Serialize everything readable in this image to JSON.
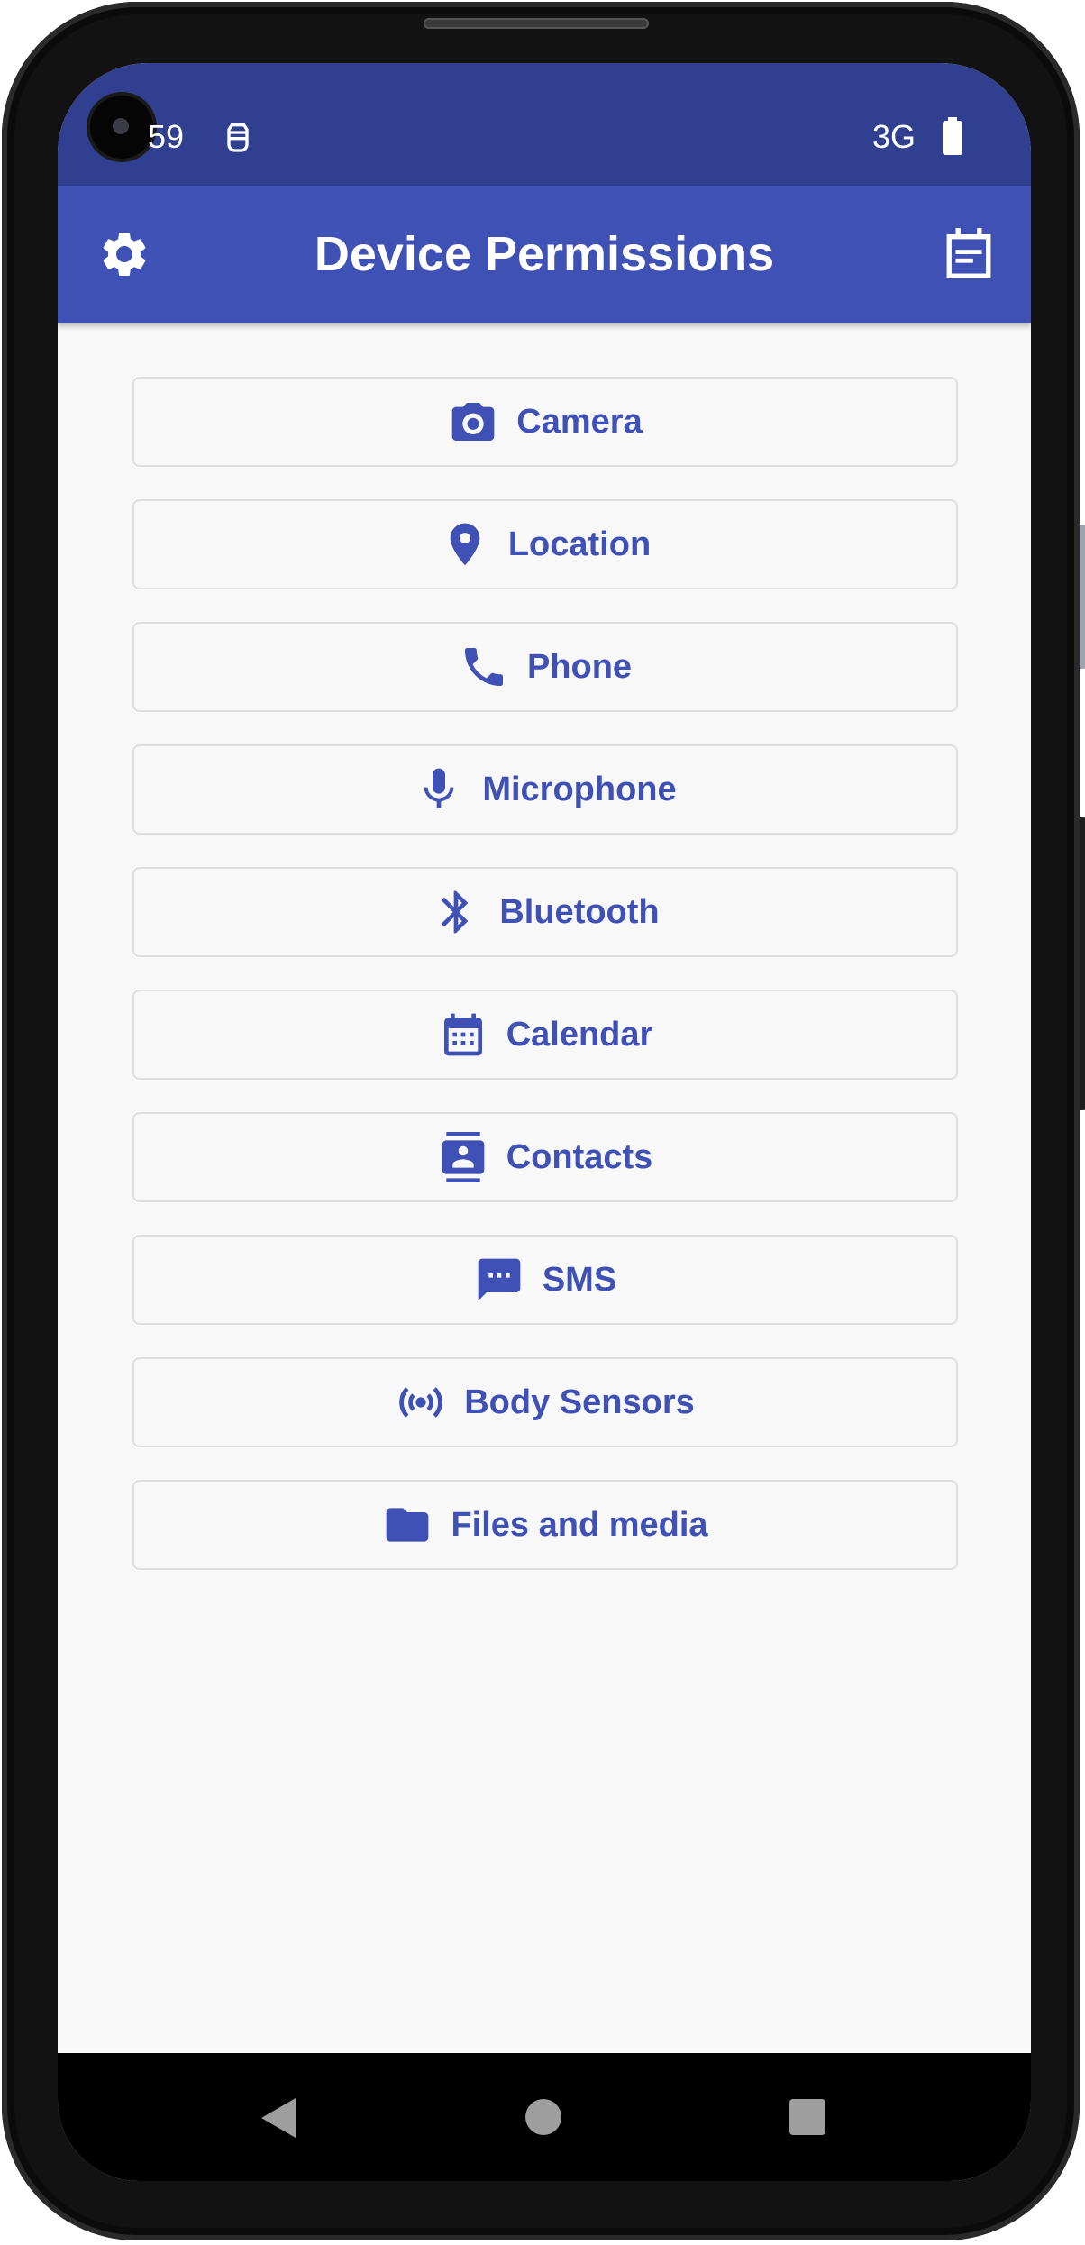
{
  "status_bar": {
    "time": "59",
    "network": "3G",
    "sim_icon": "sim-icon",
    "battery_icon": "battery-icon"
  },
  "app_bar": {
    "title": "Device Permissions",
    "left_icon": "gear-icon",
    "right_icon": "calendar-note-icon",
    "color": "#3f51b5"
  },
  "permissions": [
    {
      "label": "Camera",
      "icon": "camera-icon"
    },
    {
      "label": "Location",
      "icon": "location-pin-icon"
    },
    {
      "label": "Phone",
      "icon": "phone-icon"
    },
    {
      "label": "Microphone",
      "icon": "microphone-icon"
    },
    {
      "label": "Bluetooth",
      "icon": "bluetooth-icon"
    },
    {
      "label": "Calendar",
      "icon": "calendar-icon"
    },
    {
      "label": "Contacts",
      "icon": "contacts-icon"
    },
    {
      "label": "SMS",
      "icon": "sms-icon"
    },
    {
      "label": "Body Sensors",
      "icon": "body-sensors-icon"
    },
    {
      "label": "Files and media",
      "icon": "folder-icon"
    }
  ],
  "nav_bar": {
    "back_icon": "back-icon",
    "home_icon": "home-icon",
    "recents_icon": "recents-icon"
  },
  "colors": {
    "accent": "#3f51b5",
    "status_bar": "#303f8f",
    "background": "#f8f8f8"
  }
}
